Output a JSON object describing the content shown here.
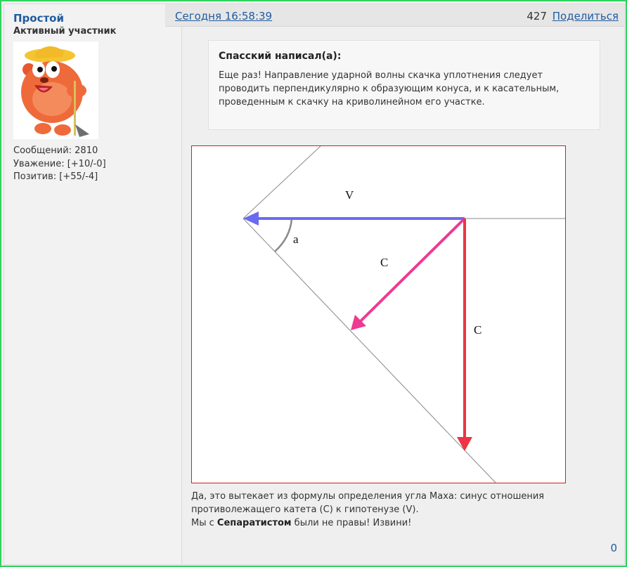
{
  "user": {
    "name": "Простой",
    "rank": "Активный участник",
    "stats": {
      "messages": "Сообщений: 2810",
      "respect": "Уважение: [+10/-0]",
      "positive": "Позитив: [+55/-4]"
    }
  },
  "post": {
    "date": "Сегодня 16:58:39",
    "number": "427",
    "share_label": "Поделиться",
    "quote": {
      "author": "Спасский написал(а):",
      "text": "Еще раз! Направление ударной волны скачка уплотнения следует проводить перпендикулярно к образующим конуса, и к касательным, проведенным к скачку на криволинейном его участке."
    },
    "diagram": {
      "label_v": "V",
      "label_a": "a",
      "label_c_diag": "C",
      "label_c_vert": "C"
    },
    "reply": {
      "line1": "Да, это вытекает из формулы определения угла Маха: синус отношения противолежащего катета  (C) к гипотенузе (V).",
      "line2_prefix": "Мы с ",
      "line2_bold": "Сепаратистом",
      "line2_suffix": " были не правы! Извини!"
    },
    "likes": "0"
  },
  "colors": {
    "frame": "#2fd35e",
    "link": "#1f5b9f",
    "arrow_v": "#6b6bf0",
    "arrow_c_diag": "#ee3a92",
    "arrow_c_vert": "#ee3344",
    "diagram_border": "#cc2020"
  }
}
